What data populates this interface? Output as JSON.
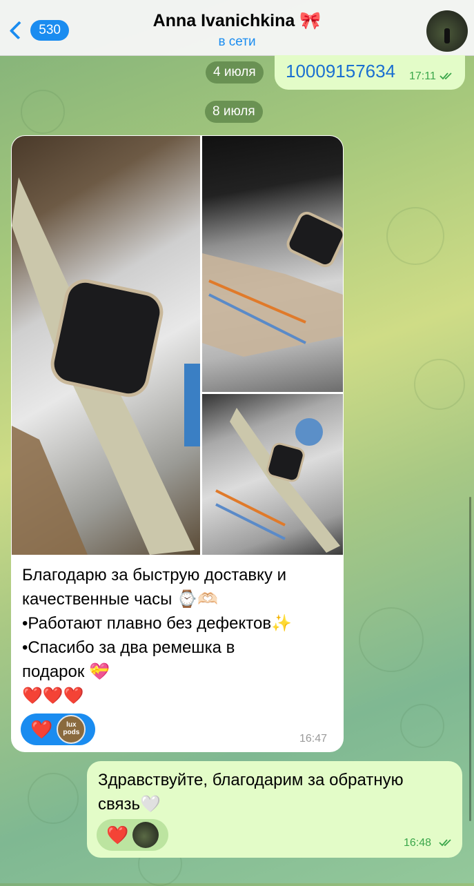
{
  "header": {
    "back_count": "530",
    "contact_name": "Anna Ivanichkina 🎀",
    "status": "в сети"
  },
  "dates": [
    "4 июля",
    "8 июля"
  ],
  "messages": {
    "outgoing_number": {
      "text": "10009157634",
      "time": "17:11"
    },
    "incoming_review": {
      "lines": [
        "Благодарю за быструю доставку и",
        "качественные часы ⌚🫶🏻",
        "•Работают плавно без дефектов✨",
        "•Спасибо за два ремешка в",
        "подарок 💝",
        "❤️❤️❤️"
      ],
      "time": "16:47",
      "reaction": "❤️",
      "reactor_avatar_text": [
        "lux",
        "pods"
      ]
    },
    "outgoing_reply": {
      "lines": [
        "Здравствуйте, благодарим за обратную",
        "связь🤍"
      ],
      "time": "16:48",
      "reaction": "❤️"
    }
  },
  "colors": {
    "accent": "#1a8cf0",
    "outgoing_bubble": "#e3fcc8",
    "outgoing_time": "#3aa64a"
  }
}
